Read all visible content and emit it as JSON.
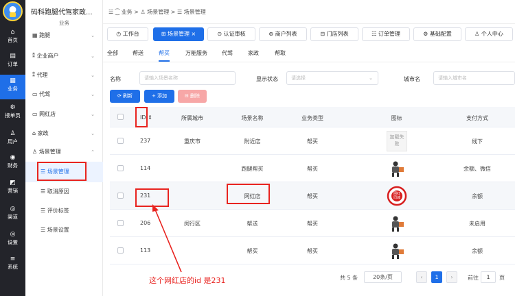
{
  "app": {
    "title": "码科跑腿代驾家政..."
  },
  "rail": [
    {
      "icon": "⌂",
      "label": "首页"
    },
    {
      "icon": "▤",
      "label": "订单"
    },
    {
      "icon": "▦",
      "label": "业务"
    },
    {
      "icon": "⚙",
      "label": "接单员"
    },
    {
      "icon": "♙",
      "label": "用户"
    },
    {
      "icon": "◉",
      "label": "财务"
    },
    {
      "icon": "◩",
      "label": "营销"
    },
    {
      "icon": "◎",
      "label": "渠道"
    },
    {
      "icon": "◎",
      "label": "设置"
    },
    {
      "icon": "≡",
      "label": "系统"
    }
  ],
  "sidebar": {
    "caption": "业务",
    "items": [
      {
        "icon": "▦",
        "label": "跑腿"
      },
      {
        "icon": "⁑",
        "label": "企业商户"
      },
      {
        "icon": "⁑",
        "label": "代理"
      },
      {
        "icon": "▭",
        "label": "代驾"
      },
      {
        "icon": "▭",
        "label": "网红店"
      },
      {
        "icon": "⌂",
        "label": "家政"
      },
      {
        "icon": "♙",
        "label": "场景管理"
      }
    ],
    "subitems": [
      {
        "label": "场景管理"
      },
      {
        "label": "取消原因"
      },
      {
        "label": "评价标签"
      },
      {
        "label": "场景设置"
      }
    ]
  },
  "breadcrumb": "☱  ⁐ 业务  >  ♙ 场景管理  >  ☰ 场景管理",
  "tabs": [
    {
      "label": "◷ 工作台"
    },
    {
      "label": "⊞ 场景管理  ×"
    },
    {
      "label": "⊙ 认证审核"
    },
    {
      "label": "⊛ 商户列表"
    },
    {
      "label": "⊟ 门店列表"
    },
    {
      "label": "☷ 订单管理"
    },
    {
      "label": "⚙ 基础配置"
    },
    {
      "label": "♙ 个人中心"
    }
  ],
  "subtabs": [
    "全部",
    "帮送",
    "帮买",
    "万能服务",
    "代驾",
    "家政",
    "帮取"
  ],
  "filters": {
    "name_label": "名称",
    "name_placeholder": "请输入场景名称",
    "status_label": "显示状态",
    "status_placeholder": "请选择",
    "city_label": "城市名",
    "city_placeholder": "请输入城市名"
  },
  "buttons": {
    "refresh": "⟳ 刷新",
    "add": "+ 添加",
    "delete": "⊟ 删除"
  },
  "table": {
    "headers": [
      "ID ⇕",
      "所属城市",
      "场景名称",
      "业务类型",
      "图标",
      "支付方式"
    ],
    "rows": [
      {
        "id": "237",
        "city": "重庆市",
        "name": "附近店",
        "type": "帮买",
        "icon": "加载失败",
        "pay": "线下"
      },
      {
        "id": "114",
        "city": "",
        "name": "跑腿帮买",
        "type": "帮买",
        "icon": "",
        "pay": "余额、微信"
      },
      {
        "id": "231",
        "city": "",
        "name": "网红店",
        "type": "帮买",
        "icon": "",
        "pay": "余额"
      },
      {
        "id": "206",
        "city": "闵行区",
        "name": "帮送",
        "type": "帮买",
        "icon": "",
        "pay": "未启用"
      },
      {
        "id": "113",
        "city": "",
        "name": "帮买",
        "type": "帮买",
        "icon": "",
        "pay": "余额"
      }
    ]
  },
  "seal_text": "网红\n同城",
  "pagination": {
    "total": "共 5 条",
    "page_size": "20条/页",
    "current": "1",
    "goto_label": "前往",
    "goto_value": "1",
    "goto_suffix": "页"
  },
  "annotation": "这个网红店的id 是231",
  "colors": {
    "primary": "#1f6fe8",
    "danger": "#f56c6c",
    "annotation": "#e8231f"
  }
}
